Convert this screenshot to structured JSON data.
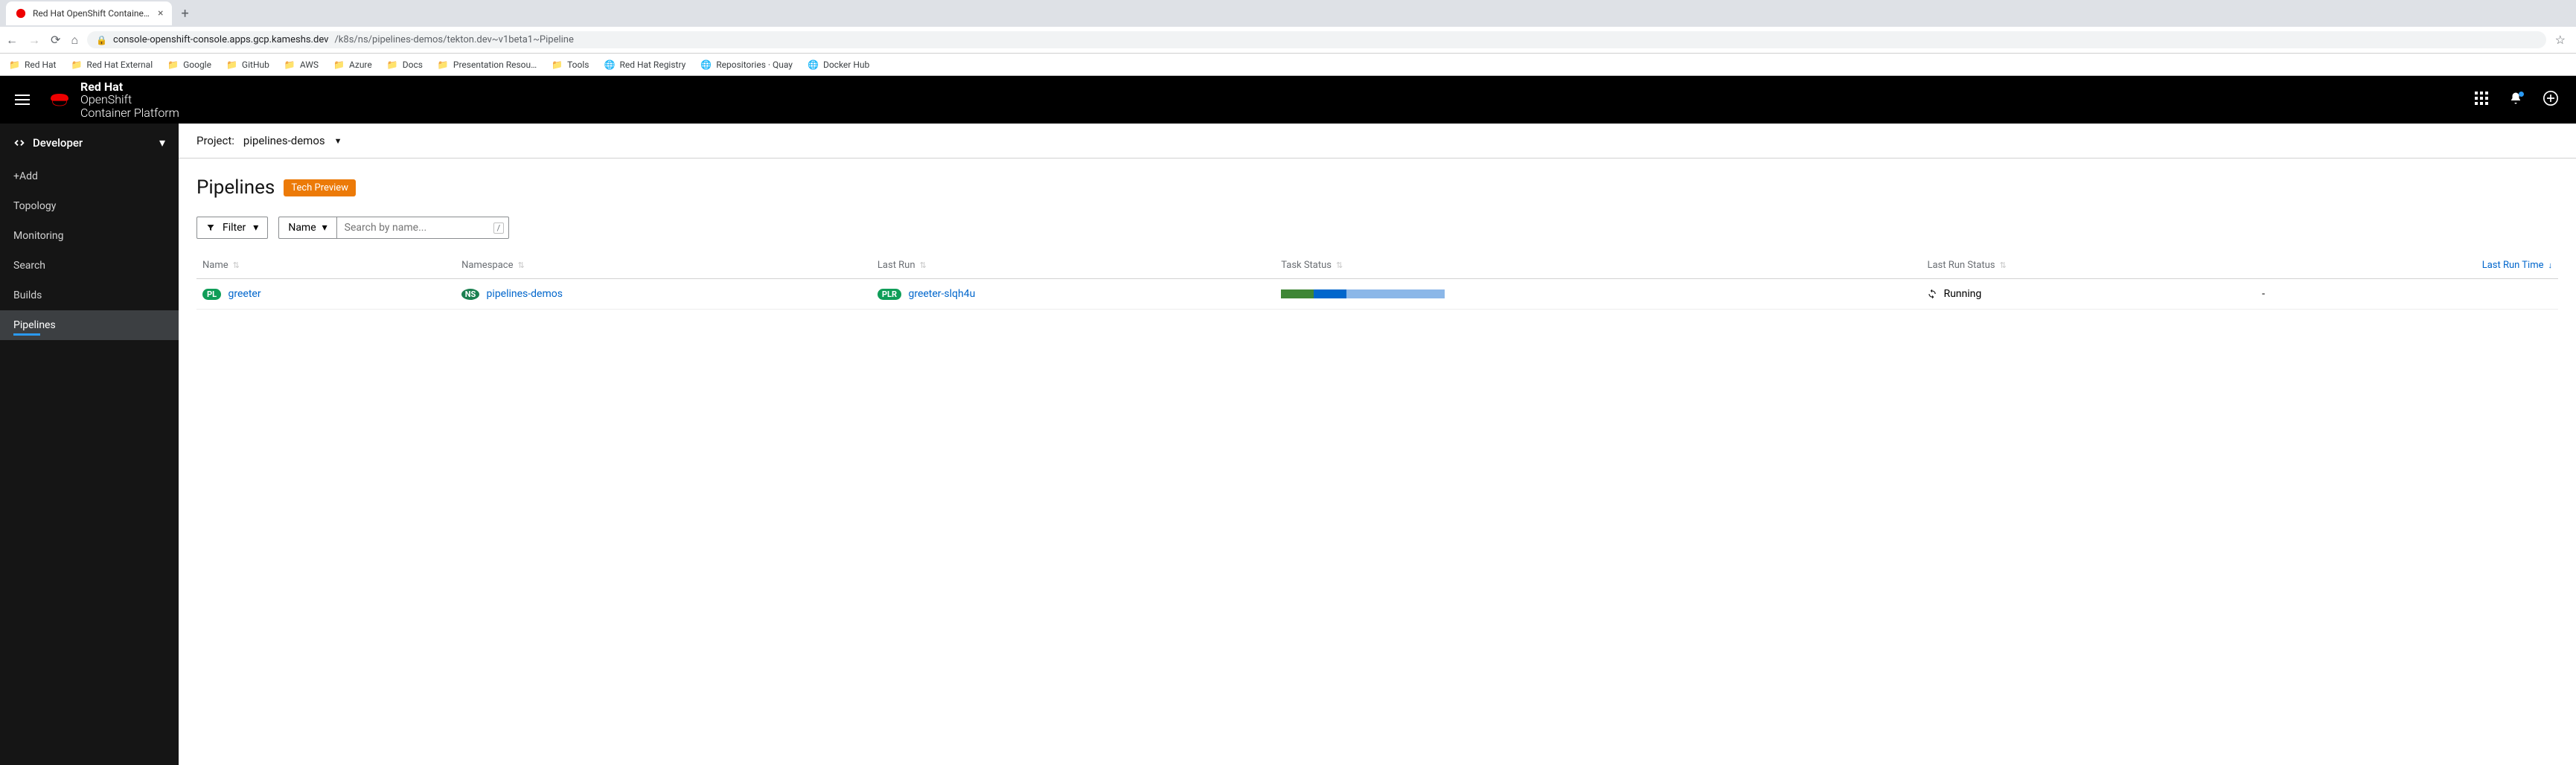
{
  "browser": {
    "tab_title": "Red Hat OpenShift Container Pla",
    "url_host": "console-openshift-console.apps.gcp.kameshs.dev",
    "url_path": "/k8s/ns/pipelines-demos/tekton.dev~v1beta1~Pipeline",
    "bookmarks": [
      "Red Hat",
      "Red Hat External",
      "Google",
      "GitHub",
      "AWS",
      "Azure",
      "Docs",
      "Presentation Resou…",
      "Tools",
      "Red Hat Registry",
      "Repositories · Quay",
      "Docker Hub"
    ]
  },
  "masthead": {
    "brand_bold": "Red Hat",
    "brand_line2": "OpenShift",
    "brand_line3": "Container Platform"
  },
  "sidebar": {
    "perspective": "Developer",
    "items": [
      "+Add",
      "Topology",
      "Monitoring",
      "Search",
      "Builds",
      "Pipelines"
    ]
  },
  "project_bar": {
    "label": "Project:",
    "value": "pipelines-demos"
  },
  "page": {
    "title": "Pipelines",
    "badge": "Tech Preview"
  },
  "toolbar": {
    "filter_label": "Filter",
    "type_label": "Name",
    "search_placeholder": "Search by name...",
    "shortcut": "/"
  },
  "table": {
    "headers": {
      "name": "Name",
      "namespace": "Namespace",
      "last_run": "Last Run",
      "task_status": "Task Status",
      "last_run_status": "Last Run Status",
      "last_run_time": "Last Run Time"
    },
    "row": {
      "pl_badge": "PL",
      "name": "greeter",
      "ns_badge": "NS",
      "namespace": "pipelines-demos",
      "plr_badge": "PLR",
      "last_run": "greeter-slqh4u",
      "status": "Running",
      "last_run_time": "-"
    }
  }
}
